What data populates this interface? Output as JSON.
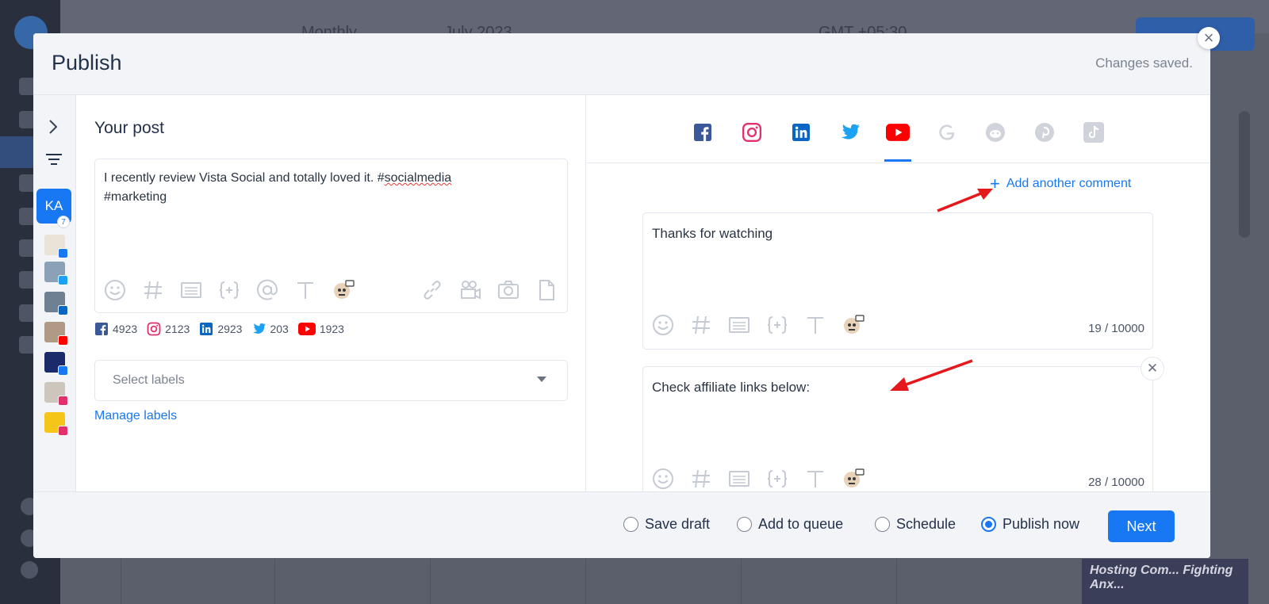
{
  "modal": {
    "title": "Publish",
    "saved_status": "Changes saved.",
    "close_icon": "×"
  },
  "rail": {
    "expand_icon": "chevron-right-icon",
    "filter_icon": "filter-icon",
    "initials": "KA",
    "badge_count": "7",
    "accounts": [
      {
        "network": "facebook",
        "color": "#1877f2"
      },
      {
        "network": "twitter",
        "color": "#1da1f2"
      },
      {
        "network": "linkedin",
        "color": "#0a66c2"
      },
      {
        "network": "youtube",
        "color": "#ff0000"
      },
      {
        "network": "facebook",
        "color": "#1877f2"
      },
      {
        "network": "instagram",
        "color": "#e1306c"
      },
      {
        "network": "instagram",
        "color": "#e1306c"
      }
    ]
  },
  "post": {
    "section_title": "Your post",
    "text_before": "I recently review Vista Social and totally loved it. #",
    "text_spell": "socialmedia",
    "text_after": "#marketing",
    "tools": [
      "emoji-icon",
      "hashtag-icon",
      "saved-captions-icon",
      "variables-icon",
      "mention-icon",
      "text-format-icon",
      "ai-assistant-icon"
    ],
    "media_tools": [
      "link-icon",
      "video-icon",
      "camera-icon",
      "document-icon"
    ]
  },
  "counts": {
    "facebook": "4923",
    "instagram": "2123",
    "linkedin": "2923",
    "twitter": "203",
    "youtube": "1923"
  },
  "labels": {
    "placeholder": "Select labels",
    "manage": "Manage labels"
  },
  "networks": {
    "tabs": [
      {
        "name": "facebook",
        "color": "#3b5998",
        "active": false,
        "enabled": true
      },
      {
        "name": "instagram",
        "color": "#e1306c",
        "active": false,
        "enabled": true
      },
      {
        "name": "linkedin",
        "color": "#0a66c2",
        "active": false,
        "enabled": true
      },
      {
        "name": "twitter",
        "color": "#1da1f2",
        "active": false,
        "enabled": true
      },
      {
        "name": "youtube",
        "color": "#ff0000",
        "active": true,
        "enabled": true
      },
      {
        "name": "google",
        "color": "#d0d4da",
        "active": false,
        "enabled": false
      },
      {
        "name": "reddit",
        "color": "#d0d4da",
        "active": false,
        "enabled": false
      },
      {
        "name": "pinterest",
        "color": "#d0d4da",
        "active": false,
        "enabled": false
      },
      {
        "name": "tiktok",
        "color": "#d0d4da",
        "active": false,
        "enabled": false
      }
    ],
    "add_comment": "Add another comment"
  },
  "comments": [
    {
      "text": "Thanks for watching",
      "count": "19 / 10000"
    },
    {
      "text": "Check affiliate links below:",
      "count": "28 / 10000"
    }
  ],
  "footer": {
    "options": [
      {
        "label": "Save draft",
        "selected": false
      },
      {
        "label": "Add to queue",
        "selected": false
      },
      {
        "label": "Schedule",
        "selected": false
      },
      {
        "label": "Publish now",
        "selected": true
      }
    ],
    "next": "Next"
  },
  "background": {
    "view_mode": "Monthly",
    "month": "July 2023",
    "timezone": "GMT +05:30",
    "thumbnail_text": "Hosting Com... Fighting Anx..."
  },
  "colors": {
    "accent": "#1877f2",
    "youtube": "#ff0000",
    "annotation_arrow": "#e5191c"
  }
}
